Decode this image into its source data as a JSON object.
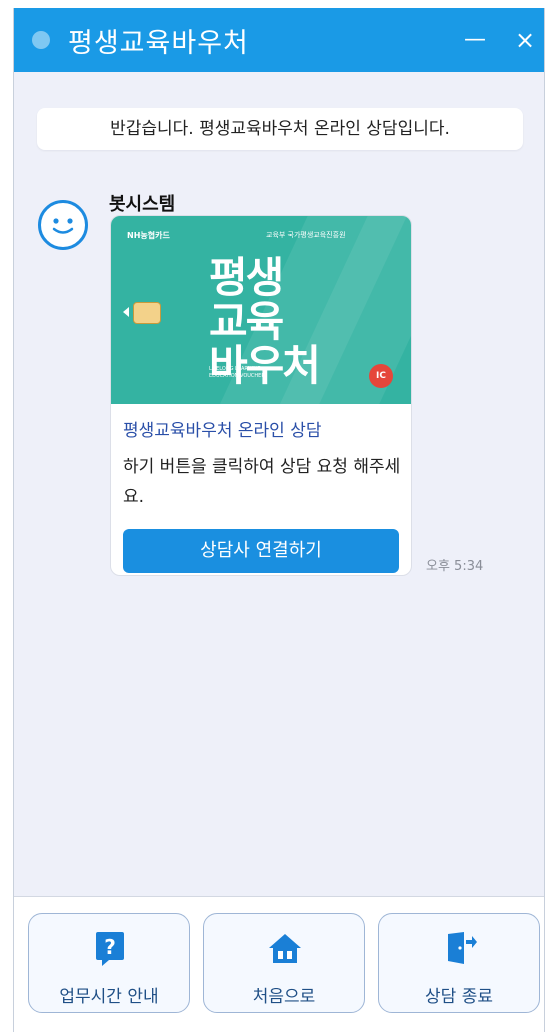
{
  "window": {
    "title": "평생교육바우처",
    "minimize_label": "—",
    "close_label": "×"
  },
  "chat": {
    "welcome": "반갑습니다. 평생교육바우처 온라인 상담입니다.",
    "bot_name": "봇시스템",
    "card": {
      "image_title_line1": "평생",
      "image_title_line2": "교육",
      "image_title_line3": "바우처",
      "image_logo_left": "NH농협카드",
      "image_logo_right": "교육부  국가평생교육진흥원",
      "image_small_text": "LIFELONG LEARNING EDUCATION VOUCHER",
      "chip_label": "IC",
      "heading": "평생교육바우처 온라인 상담",
      "body": "하기 버튼을 클릭하여 상담 요청 해주세요.",
      "button_label": "상담사 연결하기"
    },
    "time": "오후 5:34"
  },
  "footer": {
    "buttons": [
      {
        "label": "업무시간 안내",
        "icon": "question-icon"
      },
      {
        "label": "처음으로",
        "icon": "home-icon"
      },
      {
        "label": "상담 종료",
        "icon": "exit-door-icon"
      }
    ]
  },
  "colors": {
    "titlebar": "#1a9ae6",
    "card_image": "#34b3a2",
    "primary_button": "#1a8fe0",
    "background": "#eef0f9"
  }
}
